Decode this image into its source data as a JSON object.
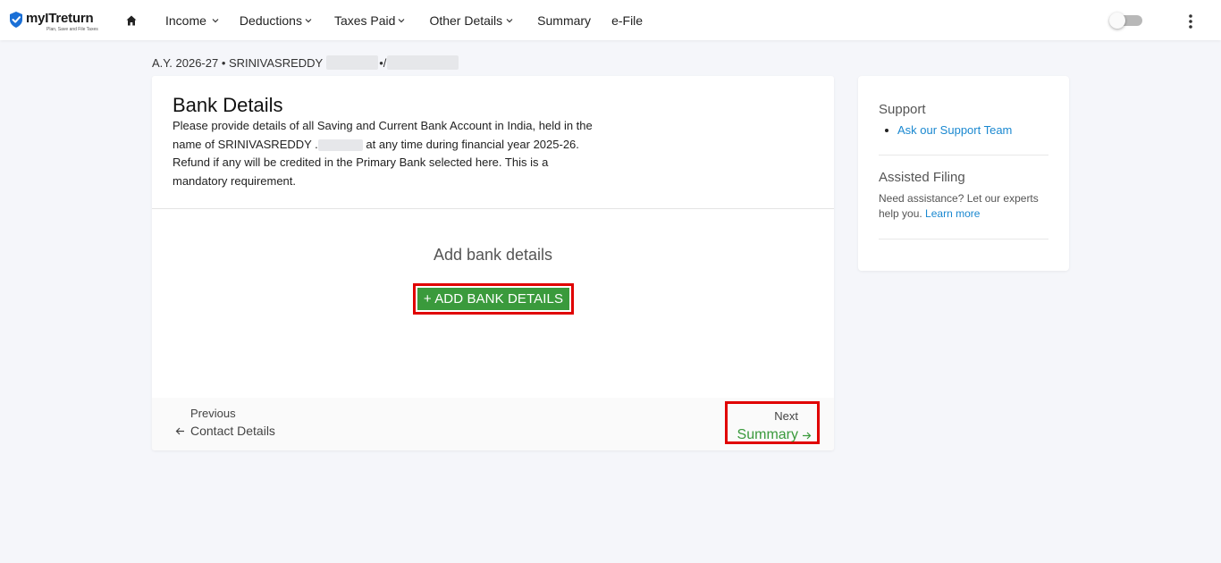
{
  "brand": {
    "name": "myITreturn",
    "tagline": "Plan, Save and File Taxes",
    "accent": "#1a6fd6"
  },
  "nav": {
    "items": [
      {
        "label": "Income",
        "dropdown": true
      },
      {
        "label": "Deductions",
        "dropdown": true
      },
      {
        "label": "Taxes Paid",
        "dropdown": true
      },
      {
        "label": "Other Details",
        "dropdown": true
      },
      {
        "label": "Summary",
        "dropdown": false
      },
      {
        "label": "e-File",
        "dropdown": false
      }
    ]
  },
  "breadcrumb": {
    "prefix": "A.Y. 2026-27 • SRINIVASREDDY",
    "separator": "•/"
  },
  "bank": {
    "title": "Bank Details",
    "desc_part1": "Please provide details of all Saving and Current Bank Account in India, held in the name of SRINIVASREDDY .",
    "desc_part2": " at any time during financial year 2025-26. Refund if any will be credited in the Primary Bank selected here. This is a mandatory requirement.",
    "add_heading": "Add bank details",
    "add_button": "+ ADD BANK DETAILS"
  },
  "footer": {
    "previous_label": "Previous",
    "previous_link": "Contact Details",
    "next_label": "Next",
    "next_link": "Summary"
  },
  "sidebar": {
    "support_title": "Support",
    "support_link": "Ask our Support Team",
    "assisted_title": "Assisted Filing",
    "assisted_text": "Need assistance? Let our experts help you.",
    "assisted_link": "Learn more"
  },
  "colors": {
    "primary_green": "#3a9a3c",
    "highlight_red": "#e00000",
    "link_blue": "#1a88d0"
  }
}
